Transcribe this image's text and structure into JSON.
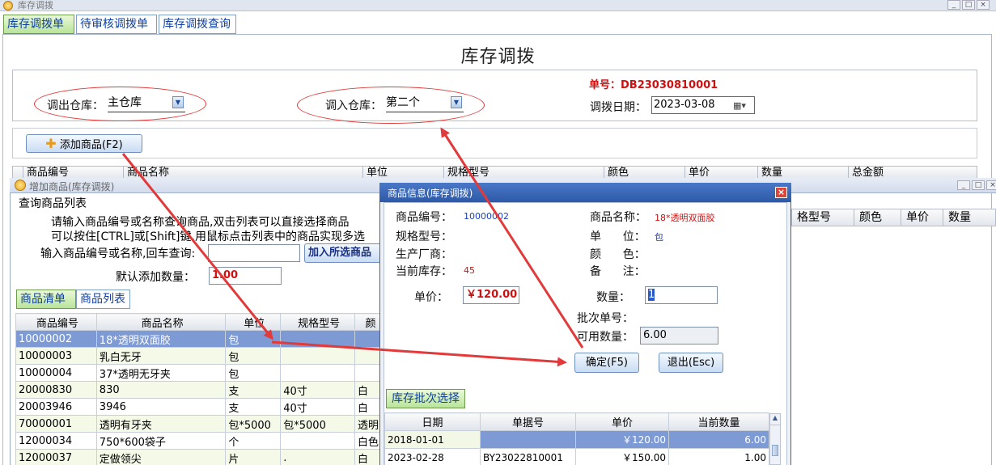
{
  "main_window": {
    "title": "库存调拨",
    "controls": [
      "_",
      "□",
      "×"
    ]
  },
  "tabs": [
    {
      "label": "库存调拨单",
      "active": true
    },
    {
      "label": "待审核调拨单",
      "active": false
    },
    {
      "label": "库存调拨查询",
      "active": false
    }
  ],
  "page_title": "库存调拨",
  "header": {
    "out_label": "调出仓库：",
    "out_value": "主仓库",
    "in_label": "调入仓库：",
    "in_value": "第二个",
    "order_no_label": "单号：",
    "order_no": "DB23030810001",
    "date_label": "调拨日期：",
    "date_value": "2023-03-08"
  },
  "add_button": "添加商品(F2)",
  "main_grid_headers": [
    "商品编号",
    "商品名称",
    "单位",
    "规格型号",
    "颜色",
    "单价",
    "数量",
    "总金额"
  ],
  "add_window": {
    "title": "增加商品(库存调拨)",
    "controls": [
      "_",
      "□",
      "×"
    ],
    "section_title": "查询商品列表",
    "hint1": "请输入商品编号或名称查询商品,双击列表可以直接选择商品",
    "hint2": "可以按住[CTRL]或[Shift]键,用鼠标点击列表中的商品实现多选",
    "search_label": "输入商品编号或名称,回车查询:",
    "search_value": "",
    "add_selected_button": "加入所选商品",
    "default_qty_label": "默认添加数量：",
    "default_qty_value": "1.00",
    "list_tabs": [
      "商品清单",
      "商品列表"
    ],
    "list_headers": [
      "商品编号",
      "商品名称",
      "单位",
      "规格型号",
      "颜"
    ],
    "rows": [
      [
        "10000002",
        "18*透明双面胶",
        "包",
        "",
        ""
      ],
      [
        "10000003",
        "乳白无牙",
        "包",
        "",
        ""
      ],
      [
        "10000004",
        "37*透明无牙夹",
        "包",
        "",
        ""
      ],
      [
        "20000830",
        "830",
        "支",
        "40寸",
        "白"
      ],
      [
        "20003946",
        "3946",
        "支",
        "40寸",
        "白"
      ],
      [
        "70000001",
        "透明有牙夹",
        "包*5000",
        "包*5000",
        "透明"
      ],
      [
        "12000034",
        "750*600袋子",
        "个",
        "",
        "白色"
      ],
      [
        "12000037",
        "定做领尖",
        "片",
        ".",
        "白"
      ]
    ],
    "right_headers": [
      "格型号",
      "颜色",
      "单价",
      "数量"
    ]
  },
  "dialog": {
    "title": "商品信息(库存调拨)",
    "close": "×",
    "code_label": "商品编号：",
    "code_value": "10000002",
    "name_label": "商品名称：",
    "name_value": "18*透明双面胶",
    "spec_label": "规格型号：",
    "unit_label": "单      位：",
    "unit_value": "包",
    "maker_label": "生产厂商：",
    "color_label": "颜      色：",
    "stock_label": "当前库存：",
    "stock_value": "45",
    "remark_label": "备      注：",
    "price_label": "单价：",
    "price_value": "￥120.00",
    "qty_label": "数量：",
    "qty_value": "1",
    "batch_no_label": "批次单号：",
    "avail_qty_label": "可用数量：",
    "avail_qty_value": "6.00",
    "confirm_button": "确定(F5)",
    "exit_button": "退出(Esc)",
    "batch_tab": "库存批次选择",
    "batch_headers": [
      "日期",
      "单据号",
      "单价",
      "当前数量"
    ],
    "batch_rows": [
      [
        "2018-01-01",
        "",
        "￥120.00",
        "6.00"
      ],
      [
        "2023-02-28",
        "BY23022810001",
        "￥150.00",
        "1.00"
      ]
    ]
  },
  "colors": {
    "annotation_red": "#e23a3a",
    "selection_blue": "#7d9ad4",
    "dialog_title": "#3a68b8"
  }
}
